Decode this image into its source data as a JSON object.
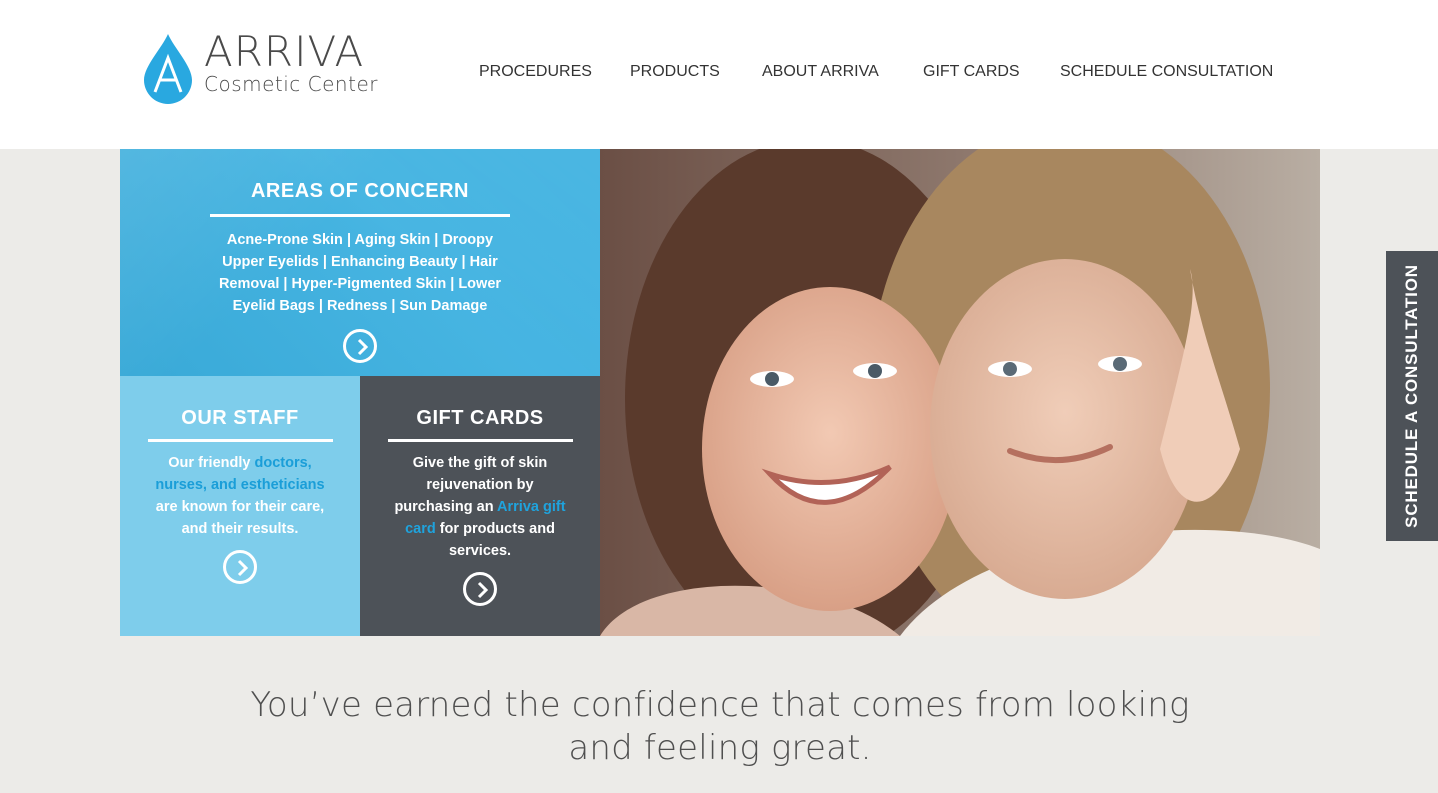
{
  "brand": {
    "name": "ARRIVA",
    "subtitle": "Cosmetic Center",
    "logo_letter": "A",
    "accent_color": "#1fa3dd"
  },
  "nav": {
    "items": [
      {
        "label": "PROCEDURES"
      },
      {
        "label": "PRODUCTS"
      },
      {
        "label": "ABOUT ARRIVA"
      },
      {
        "label": "GIFT CARDS"
      },
      {
        "label": "SCHEDULE CONSULTATION"
      }
    ]
  },
  "tiles": {
    "areas_of_concern": {
      "title": "AREAS OF CONCERN",
      "body": "Acne-Prone Skin | Aging Skin | Droopy Upper Eyelids | Enhancing Beauty | Hair Removal | Hyper-Pigmented Skin | Lower Eyelid Bags | Redness | Sun Damage",
      "icon": "chevron-circle-right-icon",
      "color": "#3bb0e0"
    },
    "our_staff": {
      "title": "OUR STAFF",
      "body_pre": "Our friendly ",
      "body_link": "doctors, nurses, and estheticians",
      "body_post": " are known for their care, and their results.",
      "icon": "chevron-circle-right-icon",
      "color": "#7ecdeb"
    },
    "gift_cards": {
      "title": "GIFT CARDS",
      "body_pre": "Give the gift of skin rejuvenation by purchasing an ",
      "body_link": "Arriva gift card",
      "body_post": " for products and services.",
      "icon": "chevron-circle-right-icon",
      "color": "#4d5258"
    }
  },
  "side_tab": {
    "label": "SCHEDULE A CONSULTATION",
    "color": "#4d5258"
  },
  "tagline": {
    "line1": "You’ve earned the confidence that comes from looking",
    "line2": "and feeling great."
  }
}
